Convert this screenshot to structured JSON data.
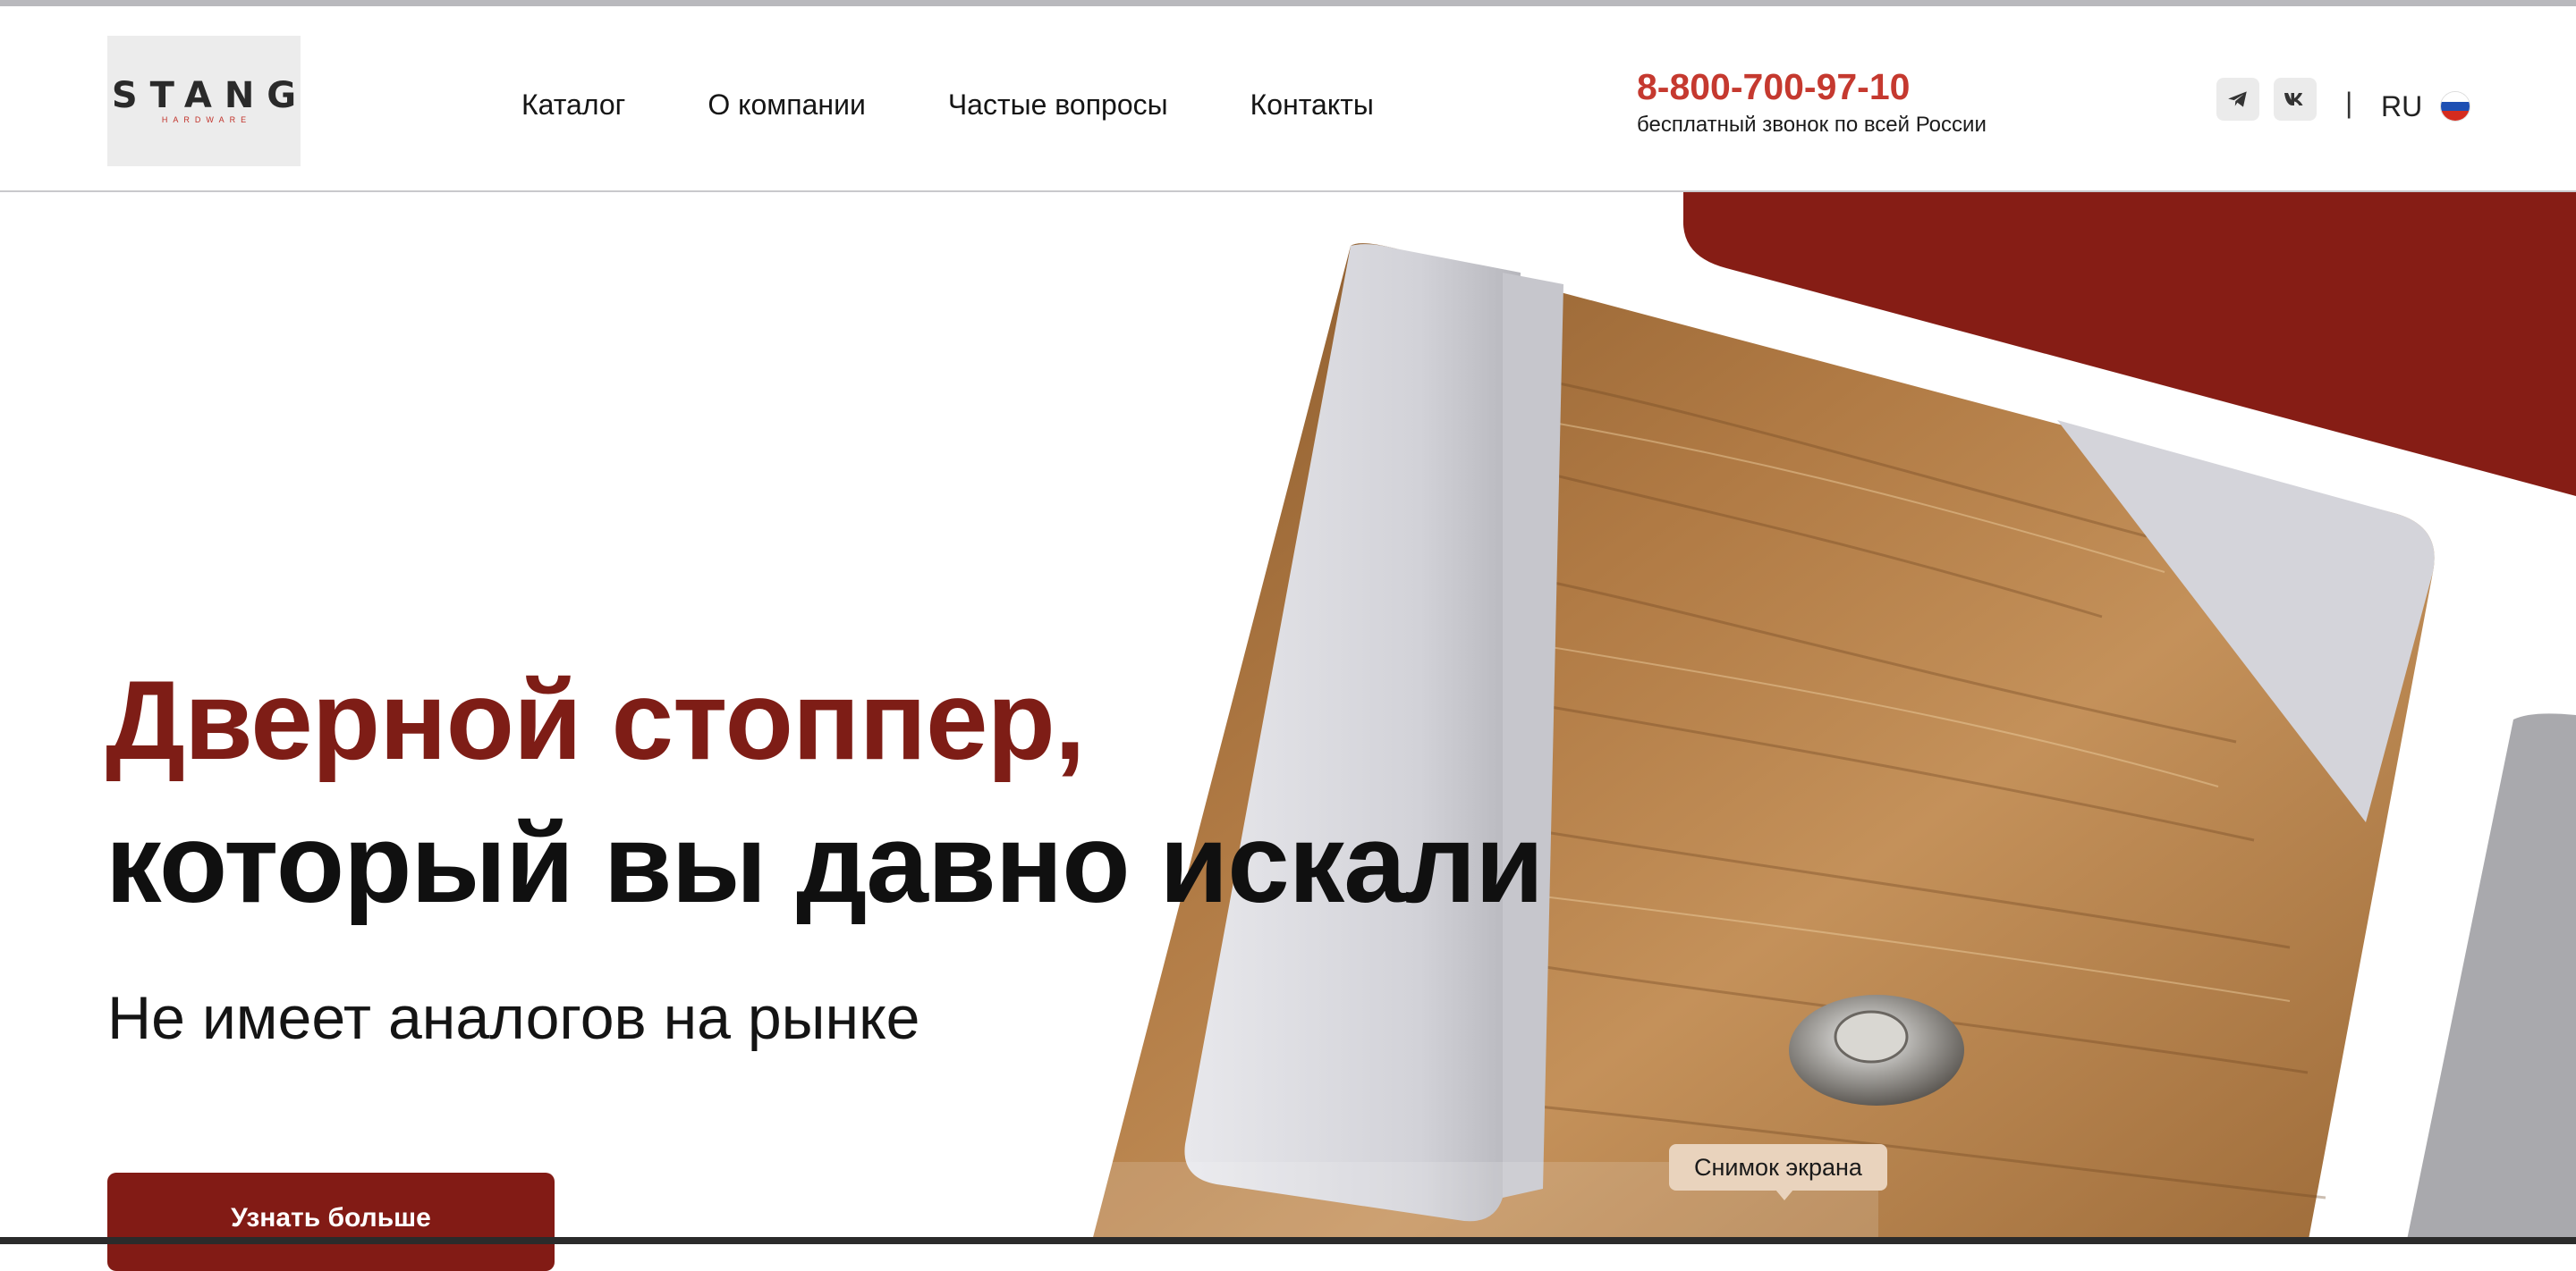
{
  "brand": {
    "logo_text": "STANG",
    "logo_subtext": "HARDWARE"
  },
  "nav": {
    "items": [
      {
        "label": "Каталог"
      },
      {
        "label": "О компании"
      },
      {
        "label": "Частые вопросы"
      },
      {
        "label": "Контакты"
      }
    ]
  },
  "contact": {
    "phone": "8-800-700-97-10",
    "phone_note": "бесплатный звонок по всей России"
  },
  "social": {
    "telegram_icon": "telegram-icon",
    "vk_icon": "vk-icon",
    "separator": "|"
  },
  "language": {
    "current": "RU",
    "flag_icon": "russia-flag-icon"
  },
  "hero": {
    "headline_accent": "Дверной стоппер,",
    "headline_main": "который вы давно искали",
    "subtitle": "Не имеет аналогов на рынке",
    "cta_label": "Узнать больше"
  },
  "overlay": {
    "tooltip": "Снимок экрана"
  },
  "colors": {
    "accent": "#c5392f",
    "brand_dark_red": "#7e1d16",
    "button": "#821b15"
  }
}
